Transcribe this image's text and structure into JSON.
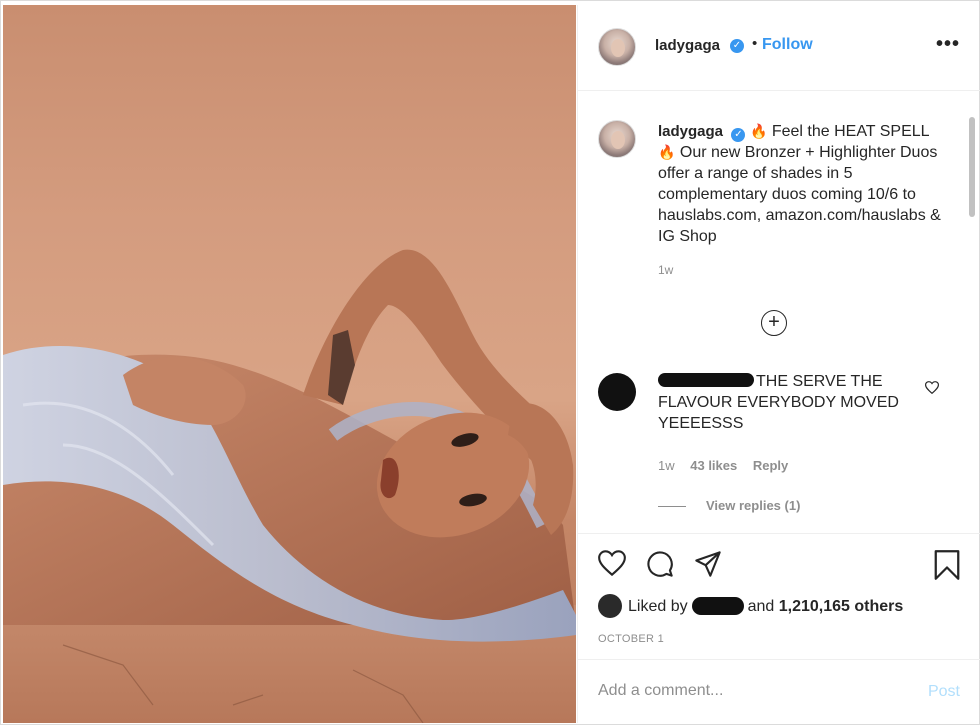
{
  "post": {
    "username": "ladygaga",
    "follow_label": "Follow",
    "separator": "•",
    "more_label": "•••",
    "verified_glyph": "✓"
  },
  "caption": {
    "username": "ladygaga",
    "line_part1": "Feel the HEAT SPELL",
    "line_part2": "Our new Bronzer + Highlighter Duos offer a range of shades in 5 complementary duos coming 10/6 to hauslabs.com, amazon.com/hauslabs & IG Shop",
    "time": "1w",
    "flame_emoji": "🔥"
  },
  "comment": {
    "text": "THE SERVE THE FLAVOUR EVERYBODY MOVED YEEEESSS",
    "time": "1w",
    "likes": "43 likes",
    "reply_label": "Reply",
    "view_replies": "View replies (1)"
  },
  "actions": {
    "liked_by_prefix": "Liked by",
    "liked_by_and": "and",
    "others_count": "1,210,165 others",
    "date": "OCTOBER 1"
  },
  "add_comment": {
    "placeholder": "Add a comment...",
    "post_label": "Post"
  },
  "colors": {
    "accent": "#3897f0",
    "muted": "#8e8e8e",
    "text": "#262626",
    "post_disabled": "#b2dffc"
  },
  "icons": [
    "heart-icon",
    "comment-icon",
    "share-icon",
    "bookmark-icon",
    "plus-circle-icon",
    "more-icon",
    "verified-icon"
  ]
}
